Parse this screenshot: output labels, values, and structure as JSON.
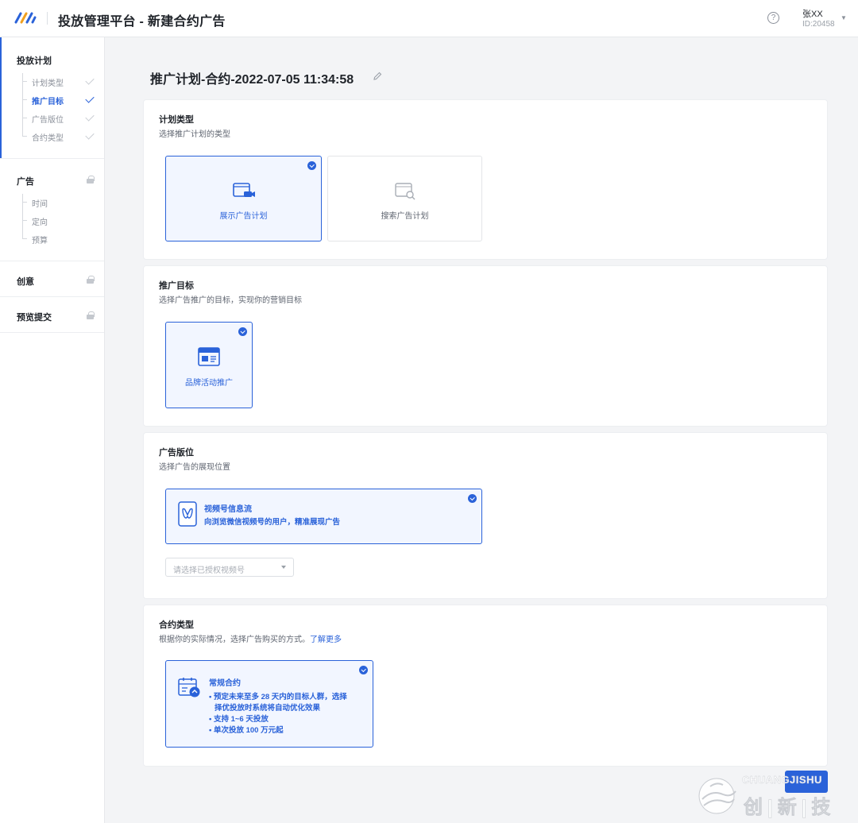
{
  "header": {
    "title": "投放管理平台 - 新建合约广告",
    "help": "?",
    "user_name": "张XX",
    "user_id": "ID:20458"
  },
  "sidebar": {
    "plan": {
      "title": "投放计划",
      "items": [
        "计划类型",
        "推广目标",
        "广告版位",
        "合约类型"
      ],
      "current": "推广目标"
    },
    "ad": {
      "title": "广告",
      "items": [
        "时间",
        "定向",
        "预算"
      ]
    },
    "creative": {
      "title": "创意"
    },
    "preview": {
      "title": "预览提交"
    }
  },
  "main": {
    "plan_title": "推广计划-合约-2022-07-05 11:34:58",
    "plan_type": {
      "title": "计划类型",
      "subtitle": "选择推广计划的类型",
      "options": [
        "展示广告计划",
        "搜索广告计划"
      ],
      "selected": "展示广告计划"
    },
    "goal": {
      "title": "推广目标",
      "subtitle": "选择广告推广的目标，实现你的营销目标",
      "options": [
        "品牌活动推广"
      ],
      "selected": "品牌活动推广"
    },
    "placement": {
      "title": "广告版位",
      "subtitle": "选择广告的展现位置",
      "option_title": "视频号信息流",
      "option_desc": "向浏览微信视频号的用户，精准展现广告",
      "select_placeholder": "请选择已授权视频号"
    },
    "contract": {
      "title": "合约类型",
      "subtitle": "根据你的实际情况，选择广告购买的方式。",
      "learn_more": "了解更多",
      "option_title": "常规合约",
      "bullets": [
        "• 预定未来至多 28 天内的目标人群，选择",
        "择优投放时系统将自动优化效果",
        "• 支持 1~6 天投放",
        "• 单次投放 100 万元起"
      ]
    }
  },
  "watermark": {
    "en": "CHUANGJISHU",
    "cn": "创|新|技"
  },
  "colors": {
    "accent": "#2a62d9",
    "selected_bg": "#f2f6ff",
    "page_bg": "#f3f4f6"
  }
}
